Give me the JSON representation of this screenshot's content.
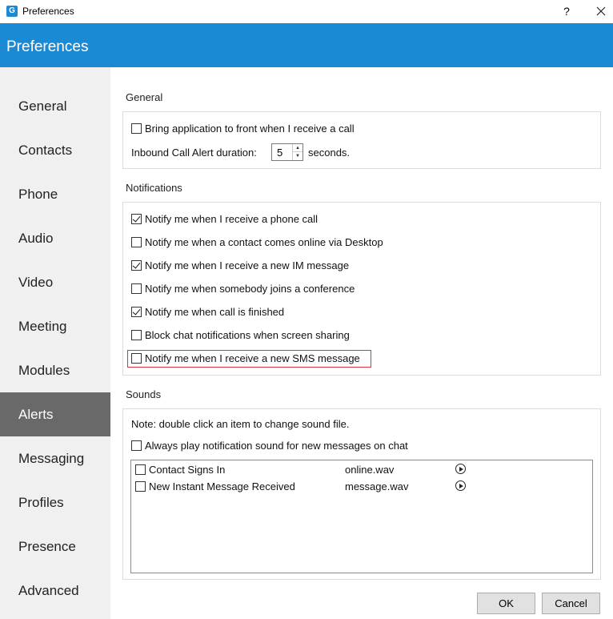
{
  "window": {
    "title": "Preferences",
    "help_label": "?"
  },
  "header": {
    "title": "Preferences"
  },
  "sidebar": {
    "items": [
      {
        "label": "General"
      },
      {
        "label": "Contacts"
      },
      {
        "label": "Phone"
      },
      {
        "label": "Audio"
      },
      {
        "label": "Video"
      },
      {
        "label": "Meeting"
      },
      {
        "label": "Modules"
      },
      {
        "label": "Alerts"
      },
      {
        "label": "Messaging"
      },
      {
        "label": "Profiles"
      },
      {
        "label": "Presence"
      },
      {
        "label": "Advanced"
      }
    ],
    "active": "Alerts"
  },
  "general": {
    "title": "General",
    "bring_front": {
      "label": "Bring application to front when I receive a call",
      "checked": false
    },
    "duration_label": "Inbound Call Alert duration:",
    "duration_value": "5",
    "duration_unit": "seconds."
  },
  "notifications": {
    "title": "Notifications",
    "items": [
      {
        "label": "Notify me when I receive a phone call",
        "checked": true
      },
      {
        "label": "Notify me when a contact comes online via Desktop",
        "checked": false
      },
      {
        "label": "Notify me when I receive a new IM message",
        "checked": true
      },
      {
        "label": "Notify me when somebody joins a conference",
        "checked": false
      },
      {
        "label": "Notify me when call is finished",
        "checked": true
      },
      {
        "label": "Block chat notifications when screen sharing",
        "checked": false
      },
      {
        "label": "Notify me when I receive a new SMS message",
        "checked": false
      }
    ]
  },
  "sounds": {
    "title": "Sounds",
    "note": "Note: double click an item to change sound file.",
    "always_play": {
      "label": "Always play notification sound for new messages on chat",
      "checked": false
    },
    "list": [
      {
        "event": "Contact Signs In",
        "file": "online.wav",
        "checked": false
      },
      {
        "event": "New Instant Message Received",
        "file": "message.wav",
        "checked": false
      }
    ]
  },
  "buttons": {
    "ok": "OK",
    "cancel": "Cancel"
  },
  "colors": {
    "accent": "#1a8ad4",
    "sidebar_active": "#696969",
    "highlight": "#d9333f"
  }
}
